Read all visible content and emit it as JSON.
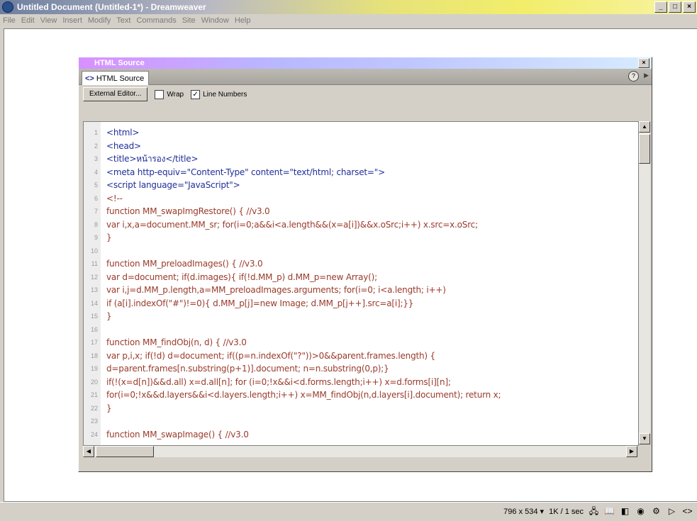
{
  "window": {
    "title": "Untitled Document (Untitled-1*) - Dreamweaver",
    "controls": [
      "_",
      "□",
      "×"
    ]
  },
  "menu": [
    "File",
    "Edit",
    "View",
    "Insert",
    "Modify",
    "Text",
    "Commands",
    "Site",
    "Window",
    "Help"
  ],
  "panel": {
    "title": "HTML Source",
    "tab_label": "HTML Source",
    "close_label": "×",
    "help_label": "?",
    "options_label": "▶"
  },
  "toolbar": {
    "external_editor_label": "External Editor...",
    "wrap_label": "Wrap",
    "wrap_checked": false,
    "line_numbers_label": "Line Numbers",
    "line_numbers_checked": true
  },
  "code": {
    "line_numbers": [
      "1",
      "2",
      "3",
      "4",
      "5",
      "6",
      "7",
      "8",
      "9",
      "10",
      "11",
      "12",
      "13",
      "14",
      "15",
      "16",
      "17",
      "18",
      "19",
      "20",
      "21",
      "22",
      "23",
      "24"
    ],
    "lines": [
      "<html>",
      "<head>",
      "<title>หน้ารอง</title>",
      "<meta http-equiv=\"Content-Type\" content=\"text/html; charset=\">",
      "<script language=\"JavaScript\">",
      "<!--",
      "function MM_swapImgRestore() { //v3.0",
      "  var i,x,a=document.MM_sr; for(i=0;a&&i<a.length&&(x=a[i])&&x.oSrc;i++) x.src=x.oSrc;",
      "}",
      "",
      "function MM_preloadImages() { //v3.0",
      "  var d=document; if(d.images){ if(!d.MM_p) d.MM_p=new Array();",
      "    var i,j=d.MM_p.length,a=MM_preloadImages.arguments; for(i=0; i<a.length; i++)",
      "    if (a[i].indexOf(\"#\")!=0){ d.MM_p[j]=new Image; d.MM_p[j++].src=a[i];}}",
      "}",
      "",
      "function MM_findObj(n, d) { //v3.0",
      "  var p,i,x;  if(!d) d=document; if((p=n.indexOf(\"?\"))>0&&parent.frames.length) {",
      "    d=parent.frames[n.substring(p+1)].document; n=n.substring(0,p);}",
      "  if(!(x=d[n])&&d.all) x=d.all[n]; for (i=0;!x&&i<d.forms.length;i++) x=d.forms[i][n];",
      "  for(i=0;!x&&d.layers&&i<d.layers.length;i++) x=MM_findObj(n,d.layers[i].document); return x;",
      "}",
      "",
      "function MM_swapImage() { //v3.0"
    ]
  },
  "status": {
    "size_label": "796 x 534 ▾",
    "download_label": "1K / 1 sec"
  },
  "colors": {
    "tag": "#1f2f98",
    "script": "#9a3a2a"
  }
}
